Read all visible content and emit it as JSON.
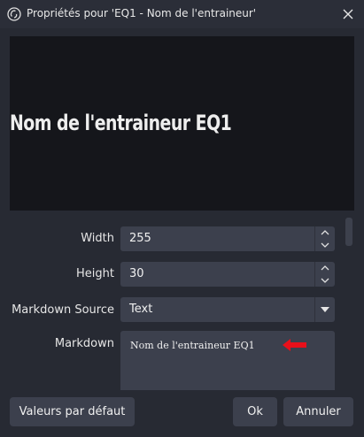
{
  "window": {
    "title": "Propriétés pour 'EQ1 - Nom de l'entraineur'"
  },
  "preview": {
    "text": "Nom de l'entraineur EQ1"
  },
  "properties": {
    "width": {
      "label": "Width",
      "value": "255"
    },
    "height": {
      "label": "Height",
      "value": "30"
    },
    "markdown_source": {
      "label": "Markdown Source",
      "value": "Text"
    },
    "markdown": {
      "label": "Markdown",
      "value": "Nom de l'entraineur EQ1"
    }
  },
  "footer": {
    "defaults_label": "Valeurs par défaut",
    "ok_label": "Ok",
    "cancel_label": "Annuler"
  },
  "icons": {
    "app": "obs-logo-icon",
    "close": "close-icon",
    "spin_up": "chevron-up-icon",
    "spin_down": "chevron-down-icon",
    "select": "caret-down-icon",
    "annotation": "red-arrow-icon"
  },
  "colors": {
    "annotation": "#e8101a"
  }
}
